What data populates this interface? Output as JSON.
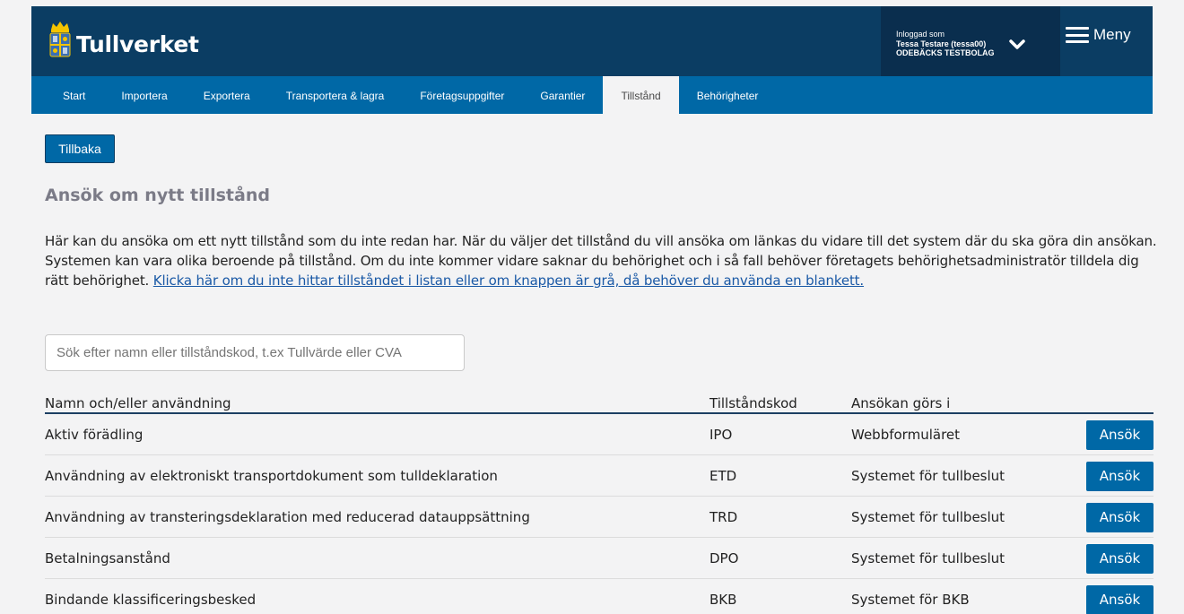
{
  "header": {
    "logo_text": "Tullverket",
    "user_small": "Inloggad som",
    "user_name": "Tessa Testare (tessa00)",
    "user_org": "ODEBÄCKS TESTBOLAG",
    "menu_label": "Meny"
  },
  "nav": {
    "items": [
      "Start",
      "Importera",
      "Exportera",
      "Transportera & lagra",
      "Företagsuppgifter",
      "Garantier",
      "Tillstånd",
      "Behörigheter"
    ],
    "active": "Tillstånd"
  },
  "back_label": "Tillbaka",
  "page_title": "Ansök om nytt tillstånd",
  "intro": {
    "text": "Här kan du ansöka om ett nytt tillstånd som du inte redan har. När du väljer det tillstånd du vill ansöka om länkas du vidare till det system där du ska göra din ansökan. Systemen kan vara olika beroende på tillstånd. Om du inte kommer vidare saknar du behörighet och i så fall behöver företagets behörighetsadministratör tilldela dig rätt behörighet. ",
    "link": "Klicka här om du inte hittar tillståndet i listan eller om knappen är grå, då behöver du använda en blankett."
  },
  "search": {
    "placeholder": "Sök efter namn eller tillståndskod, t.ex Tullvärde eller CVA"
  },
  "table": {
    "headers": [
      "Namn och/eller användning",
      "Tillståndskod",
      "Ansökan görs i"
    ],
    "button_label": "Ansök",
    "rows": [
      {
        "name": "Aktiv förädling",
        "code": "IPO",
        "system": "Webbformuläret"
      },
      {
        "name": "Användning av elektroniskt transportdokument som tulldeklaration",
        "code": "ETD",
        "system": "Systemet för tullbeslut"
      },
      {
        "name": "Användning av transteringsdeklaration med reducerad datauppsättning",
        "code": "TRD",
        "system": "Systemet för tullbeslut"
      },
      {
        "name": "Betalningsanstånd",
        "code": "DPO",
        "system": "Systemet för tullbeslut"
      },
      {
        "name": "Bindande klassificeringsbesked",
        "code": "BKB",
        "system": "Systemet för BKB"
      }
    ]
  },
  "colors": {
    "header_dark": "#0b3d63",
    "nav_blue": "#0068a6",
    "link_blue": "#1a59a6",
    "title_gray": "#7b7b87"
  },
  "icons": [
    "tullverket-crest-icon",
    "chevron-down-icon",
    "hamburger-menu-icon"
  ]
}
